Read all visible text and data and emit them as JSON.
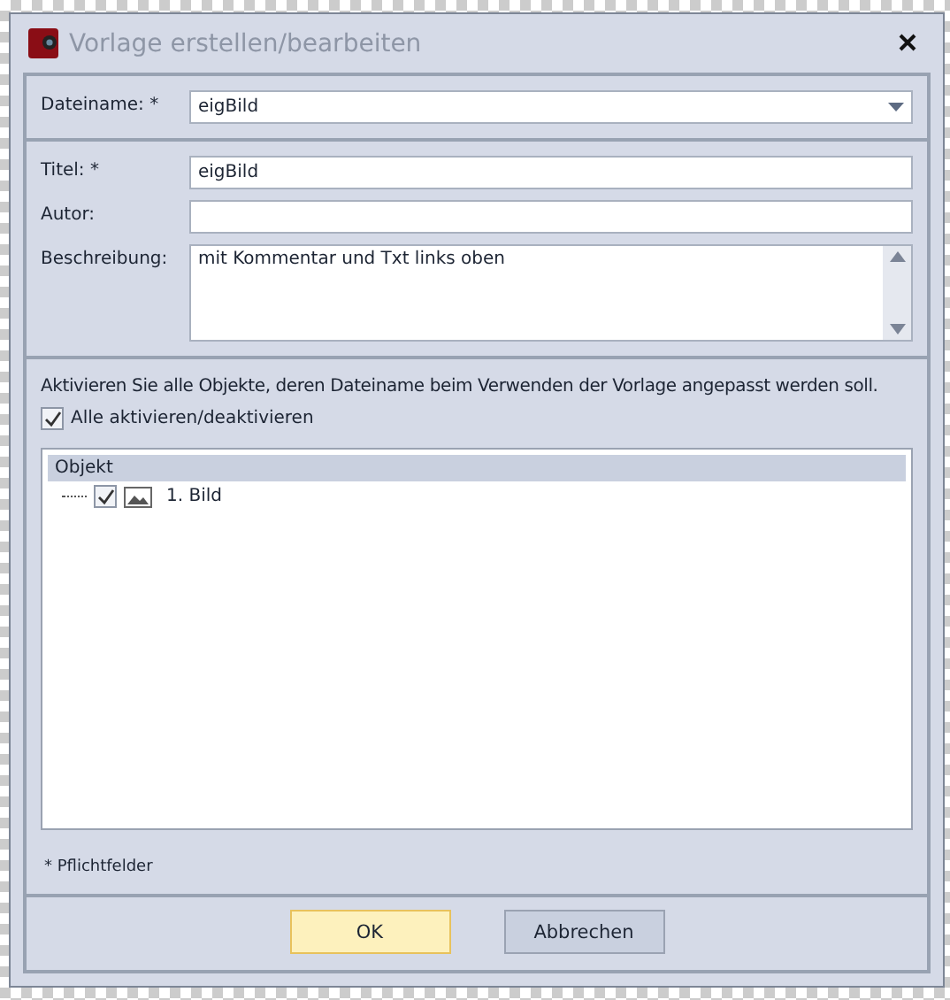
{
  "window": {
    "title": "Vorlage erstellen/bearbeiten"
  },
  "filename": {
    "label": "Dateiname: *",
    "value": "eigBild"
  },
  "fields": [
    {
      "kind": "line",
      "label": "Titel: *",
      "value": "eigBild"
    },
    {
      "kind": "line",
      "label": "Autor:"
    },
    {
      "kind": "area",
      "label": "Beschreibung:",
      "value": "mit Kommentar und Txt links oben"
    }
  ],
  "objects": {
    "hint": "Aktivieren Sie alle Objekte, deren Dateiname beim Verwenden der Vorlage angepasst werden soll.",
    "toggle_all": {
      "label": "Alle aktivieren/deaktivieren",
      "checked": true
    },
    "column": "Objekt",
    "items": [
      {
        "label": "1. Bild",
        "checked": true
      }
    ]
  },
  "footnote": "* Pflichtfelder",
  "buttons": [
    {
      "label": "OK",
      "selected": true
    },
    {
      "label": "Abbrechen",
      "selected": false
    }
  ]
}
